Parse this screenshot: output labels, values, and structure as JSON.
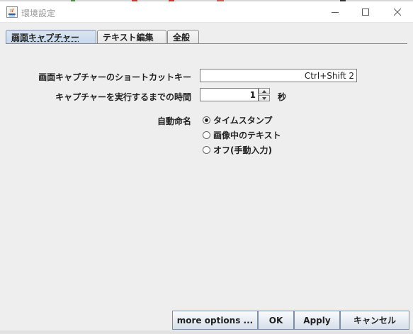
{
  "window": {
    "title": "環境設定",
    "controls": [
      "minimize",
      "maximize",
      "close"
    ]
  },
  "tabs": [
    {
      "label": "画面キャプチャー",
      "selected": true
    },
    {
      "label": "テキスト編集",
      "selected": false
    },
    {
      "label": "全般",
      "selected": false
    }
  ],
  "form": {
    "shortcut_label": "画面キャプチャーのショートカットキー",
    "shortcut_value": "Ctrl+Shift 2",
    "delay_label": "キャプチャーを実行するまでの時間",
    "delay_value": "1",
    "delay_unit": "秒",
    "auto_name_label": "自動命名",
    "auto_name_options": [
      {
        "label": "タイムスタンプ",
        "selected": true
      },
      {
        "label": "画像中のテキスト",
        "selected": false
      },
      {
        "label": "オフ(手動入力)",
        "selected": false
      }
    ]
  },
  "buttons": {
    "more_options": "more options ...",
    "ok": "OK",
    "apply": "Apply",
    "cancel": "キャンセル"
  },
  "colors": {
    "window_bg": "#eeeeee",
    "tab_selected": "#c6d7ec",
    "button_border": "#7a8ea8"
  }
}
